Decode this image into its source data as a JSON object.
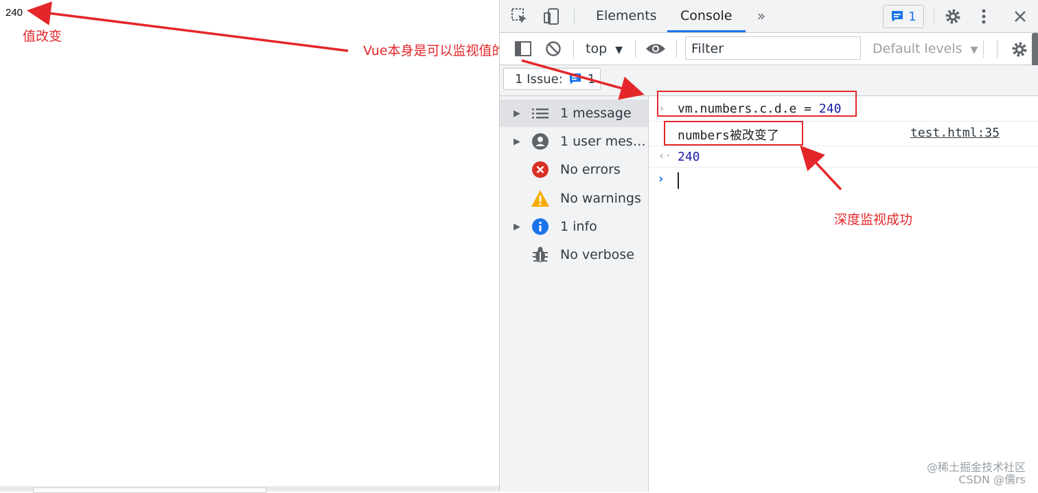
{
  "page": {
    "value": "240"
  },
  "annotations": {
    "value_changed": "值改变",
    "vue_watch": "Vue本身是可以监视值的改变",
    "deep_watch": "深度监视成功"
  },
  "devtools": {
    "tabs": [
      "Elements",
      "Console"
    ],
    "active_tab": "Console",
    "issues_count": "1",
    "context": "top",
    "filter_placeholder": "Filter",
    "levels": "Default levels",
    "issue_bar_label": "1 Issue:",
    "issue_bar_count": "1",
    "sidebar": [
      {
        "label": "1 message",
        "icon": "list-icon",
        "expandable": true,
        "selected": true
      },
      {
        "label": "1 user mess…",
        "icon": "user-icon",
        "expandable": true
      },
      {
        "label": "No errors",
        "icon": "error-icon",
        "expandable": false
      },
      {
        "label": "No warnings",
        "icon": "warning-icon",
        "expandable": false
      },
      {
        "label": "1 info",
        "icon": "info-icon",
        "expandable": true
      },
      {
        "label": "No verbose",
        "icon": "bug-icon",
        "expandable": false
      }
    ],
    "console": {
      "input_expr": "vm.numbers.c.d.e = ",
      "input_value": "240",
      "log_text": "numbers被改变了",
      "log_source": "test.html:35",
      "result_value": "240"
    }
  },
  "watermark": "@稀土掘金技术社区\nCSDN @儒rs",
  "colors": {
    "annotation": "#e4262a",
    "accent": "#1a73e8",
    "number": "#1a1aa6"
  }
}
